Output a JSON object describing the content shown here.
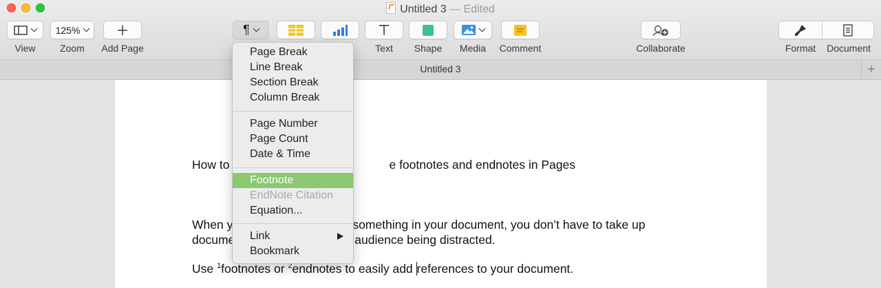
{
  "window": {
    "title": "Untitled 3",
    "status": "— Edited"
  },
  "toolbar": {
    "view_label": "View",
    "zoom_value": "125%",
    "zoom_label": "Zoom",
    "add_page_label": "Add Page",
    "insert_symbol": "¶",
    "text_label": "Text",
    "shape_label": "Shape",
    "media_label": "Media",
    "comment_label": "Comment",
    "collaborate_label": "Collaborate",
    "format_label": "Format",
    "document_label": "Document"
  },
  "tab": {
    "title": "Untitled 3"
  },
  "document": {
    "line1": "How to use footnotes and endnotes in Pages",
    "line1_visible_left": "How to",
    "line1_visible_right": "e footnotes and endnotes in Pages",
    "line2_left": "When y",
    "line2_right": "something in your document, you don’t have to take up",
    "line3_left": "docume",
    "line3_right": "audience being distracted.",
    "line4_prefix": "Use ",
    "sup1": "1",
    "line4_mid": "footnotes or ",
    "sup2": "2",
    "line4_after": "endnotes to easily add ",
    "line4_end": "references to your document."
  },
  "insert_menu": {
    "items": [
      {
        "label": "Page Break"
      },
      {
        "label": "Line Break"
      },
      {
        "label": "Section Break"
      },
      {
        "label": "Column Break"
      },
      {
        "label": "Page Number"
      },
      {
        "label": "Page Count"
      },
      {
        "label": "Date & Time"
      },
      {
        "label": "Footnote",
        "state": "highlighted"
      },
      {
        "label": "EndNote Citation",
        "state": "disabled"
      },
      {
        "label": "Equation..."
      },
      {
        "label": "Link"
      },
      {
        "label": "Bookmark"
      }
    ]
  },
  "colors": {
    "menu_highlight": "#8bc870",
    "window_bg": "#e3e3e3"
  }
}
